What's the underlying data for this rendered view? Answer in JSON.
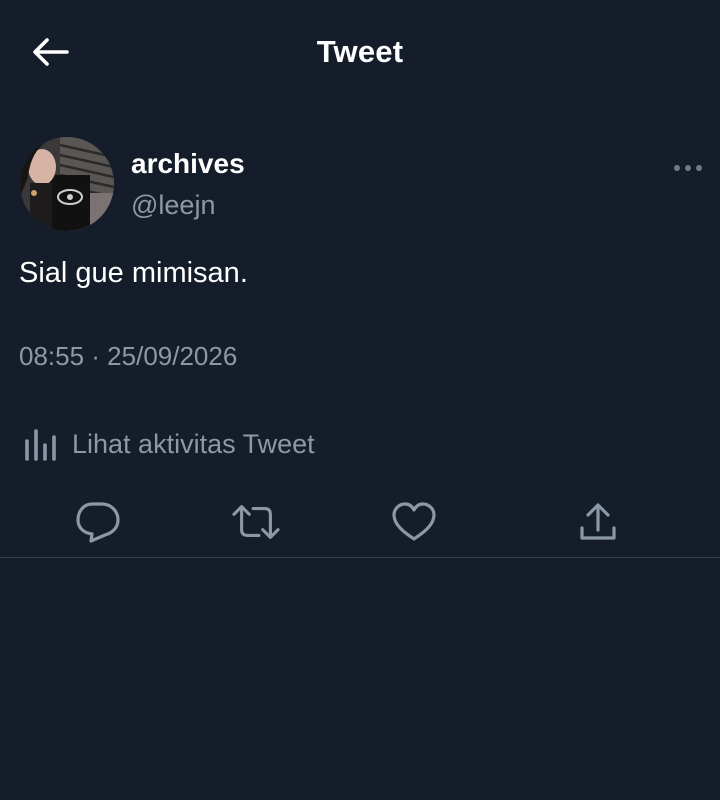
{
  "header": {
    "title": "Tweet",
    "back_icon": "arrow-left-icon"
  },
  "tweet": {
    "display_name": "archives",
    "handle": "@leejn",
    "text": "Sial gue mimisan.",
    "timestamp": "08:55 · 25/09/2026",
    "more_icon": "more-horizontal-icon"
  },
  "activity": {
    "label": "Lihat aktivitas Tweet",
    "icon": "bar-chart-icon"
  },
  "actions": [
    {
      "name": "reply",
      "icon": "reply-icon"
    },
    {
      "name": "retweet",
      "icon": "retweet-icon"
    },
    {
      "name": "like",
      "icon": "heart-icon"
    },
    {
      "name": "share",
      "icon": "share-icon"
    }
  ],
  "colors": {
    "background": "#161d2a",
    "primary_text": "#ffffff",
    "secondary_text": "#8b98a5",
    "divider": "#38444d"
  }
}
